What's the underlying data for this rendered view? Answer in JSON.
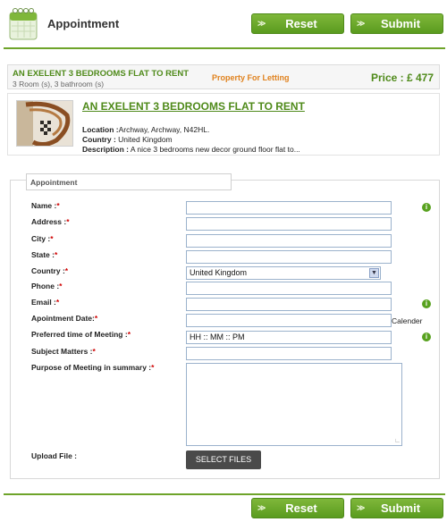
{
  "header": {
    "title": "Appointment",
    "reset_label": "Reset",
    "submit_label": "Submit"
  },
  "property": {
    "name_small": "AN EXELENT 3 BEDROOMS FLAT TO RENT",
    "rooms": "3 Room (s), 3 bathroom (s)",
    "type": "Property For Letting",
    "price": "Price : £ 477",
    "title_link": "AN EXELENT 3 BEDROOMS FLAT TO RENT",
    "location_label": "Location :",
    "location_value": "Archway, Archway, N42HL.",
    "country_label": "Country :",
    "country_value": " United Kingdom",
    "description_label": "Description :",
    "description_value": " A nice 3 bedrooms new decor ground floor flat to..."
  },
  "form": {
    "legend": "Appointment",
    "fields": [
      {
        "label": "Name :",
        "req": "*",
        "value": ""
      },
      {
        "label": "Address :",
        "req": "*",
        "value": ""
      },
      {
        "label": "City :",
        "req": "*",
        "value": ""
      },
      {
        "label": "State :",
        "req": "*",
        "value": ""
      },
      {
        "label": "Country :",
        "req": "*",
        "value": "United Kingdom"
      },
      {
        "label": "Phone :",
        "req": "*",
        "value": ""
      },
      {
        "label": "Email :",
        "req": "*",
        "value": ""
      },
      {
        "label": "Apointment Date:",
        "req": "*",
        "value": ""
      },
      {
        "label": "Preferred time of Meeting :",
        "req": "*",
        "value": "HH :: MM :: PM"
      },
      {
        "label": "Subject Matters :",
        "req": "*",
        "value": ""
      },
      {
        "label": "Purpose of Meeting in summary :",
        "req": "*",
        "value": ""
      },
      {
        "label": "Upload File :",
        "req": "",
        "value": ""
      }
    ],
    "calendar_label": "Calender",
    "select_files_label": "SELECT FILES"
  },
  "footer": {
    "reset_label": "Reset",
    "submit_label": "Submit"
  },
  "colors": {
    "accent_green": "#5a9b1f",
    "price_green": "#4f8a1a",
    "letting_orange": "#e0821e",
    "required_red": "#d00000"
  },
  "icons": [
    "calendar-icon",
    "arrow-right-icon",
    "info-icon",
    "chevron-down-icon"
  ]
}
